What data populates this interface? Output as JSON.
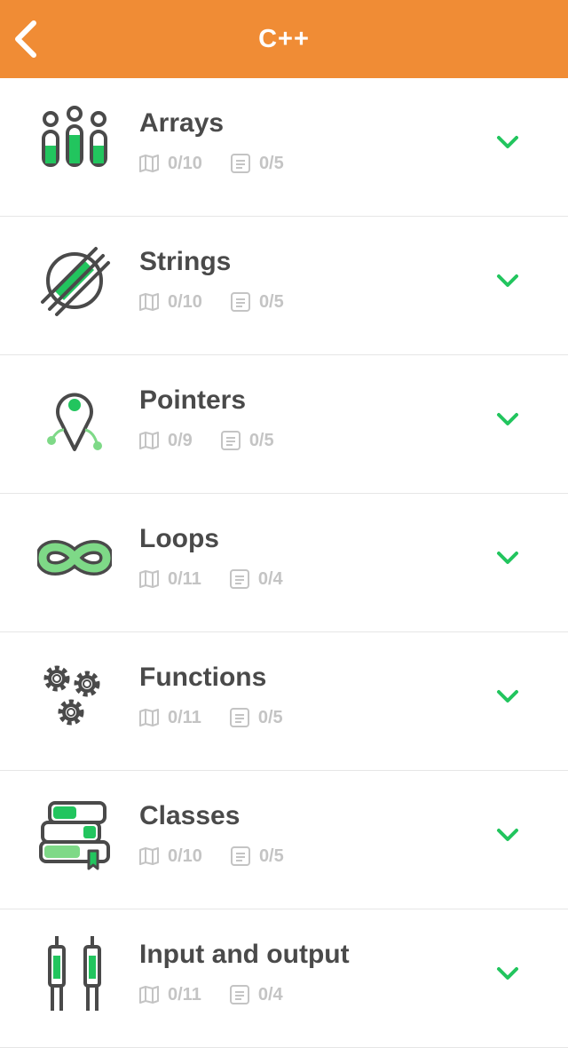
{
  "header": {
    "title": "C++"
  },
  "topics": [
    {
      "title": "Arrays",
      "lessons": "0/10",
      "quizzes": "0/5",
      "icon": "arrays-icon"
    },
    {
      "title": "Strings",
      "lessons": "0/10",
      "quizzes": "0/5",
      "icon": "strings-icon"
    },
    {
      "title": "Pointers",
      "lessons": "0/9",
      "quizzes": "0/5",
      "icon": "pointers-icon"
    },
    {
      "title": "Loops",
      "lessons": "0/11",
      "quizzes": "0/4",
      "icon": "loops-icon"
    },
    {
      "title": "Functions",
      "lessons": "0/11",
      "quizzes": "0/5",
      "icon": "functions-icon"
    },
    {
      "title": "Classes",
      "lessons": "0/10",
      "quizzes": "0/5",
      "icon": "classes-icon"
    },
    {
      "title": "Input and output",
      "lessons": "0/11",
      "quizzes": "0/4",
      "icon": "input-output-icon"
    }
  ],
  "colors": {
    "header": "#F08C35",
    "accent": "#22C55E",
    "iconDark": "#4A4A4A",
    "meta": "#C4C4C4"
  }
}
